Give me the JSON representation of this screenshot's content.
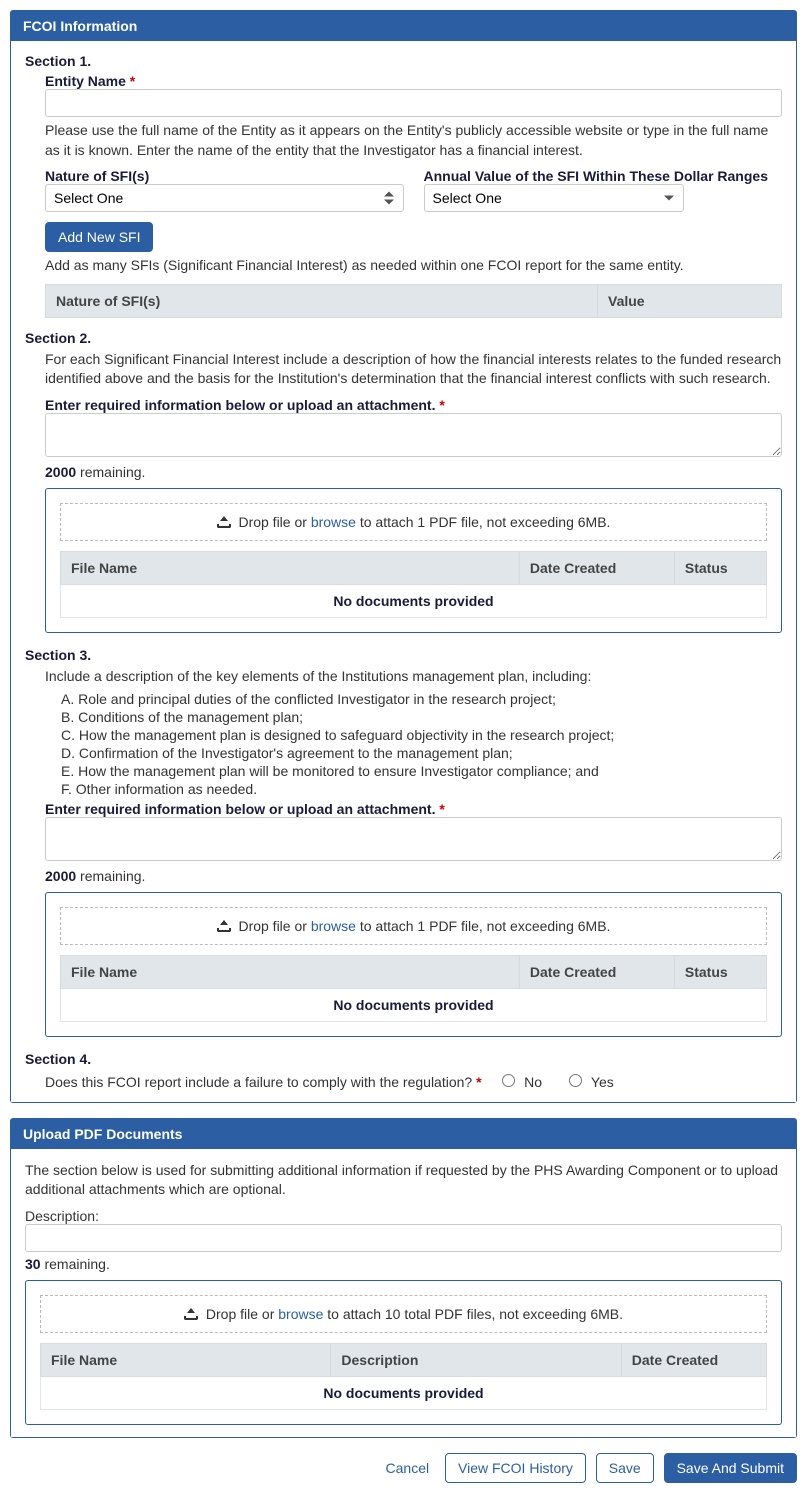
{
  "panel1": {
    "title": "FCOI Information",
    "section1": {
      "heading": "Section 1.",
      "entity_label": "Entity Name",
      "entity_help": "Please use the full name of the Entity as it appears on the Entity's publicly accessible website or type in the full name as it is known. Enter the name of the entity that the Investigator has a financial interest.",
      "nature_label": "Nature of SFI(s)",
      "value_label": "Annual Value of the SFI Within These Dollar Ranges",
      "select_placeholder": "Select One",
      "add_btn": "Add New SFI",
      "add_help": "Add as many SFIs (Significant Financial Interest) as needed within one FCOI report for the same entity.",
      "table_headers": {
        "nature": "Nature of SFI(s)",
        "value": "Value"
      }
    },
    "section2": {
      "heading": "Section 2.",
      "help": "For each Significant Financial Interest include a description of how the financial interests relates to the funded research identified above and the basis for the Institution's determination that the financial interest conflicts with such research.",
      "input_label": "Enter required information below or upload an attachment.",
      "counter_num": "2000",
      "counter_suffix": " remaining.",
      "drop_prefix": " Drop file or ",
      "drop_link": "browse",
      "drop_suffix": " to attach 1 PDF file, not exceeding 6MB.",
      "table": {
        "file": "File Name",
        "date": "Date Created",
        "status": "Status",
        "empty": "No documents provided"
      }
    },
    "section3": {
      "heading": "Section 3.",
      "help": "Include a description of the key elements of the Institutions management plan, including:",
      "items": {
        "a": "A. Role and principal duties of the conflicted Investigator in the research project;",
        "b": "B. Conditions of the management plan;",
        "c": "C. How the management plan is designed to safeguard objectivity in the research project;",
        "d": "D. Confirmation of the Investigator's agreement to the management plan;",
        "e": "E. How the management plan will be monitored to ensure Investigator compliance; and",
        "f": "F. Other information as needed."
      },
      "input_label": "Enter required information below or upload an attachment.",
      "counter_num": "2000",
      "counter_suffix": " remaining.",
      "drop_prefix": " Drop file or ",
      "drop_link": "browse",
      "drop_suffix": " to attach 1 PDF file, not exceeding 6MB.",
      "table": {
        "file": "File Name",
        "date": "Date Created",
        "status": "Status",
        "empty": "No documents provided"
      }
    },
    "section4": {
      "heading": "Section 4.",
      "question": "Does this FCOI report include a failure to comply with the regulation?",
      "no": "No",
      "yes": "Yes"
    }
  },
  "panel2": {
    "title": "Upload PDF Documents",
    "help": "The section below is used for submitting additional information if requested by the PHS Awarding Component or to upload additional attachments which are optional.",
    "desc_label": "Description:",
    "counter_num": "30",
    "counter_suffix": " remaining.",
    "drop_prefix": " Drop file or ",
    "drop_link": "browse",
    "drop_suffix": " to attach 10 total PDF files, not exceeding 6MB.",
    "table": {
      "file": "File Name",
      "desc": "Description",
      "date": "Date Created",
      "empty": "No documents provided"
    }
  },
  "footer": {
    "cancel": "Cancel",
    "view": "View FCOI History",
    "save": "Save",
    "submit": "Save And Submit"
  }
}
